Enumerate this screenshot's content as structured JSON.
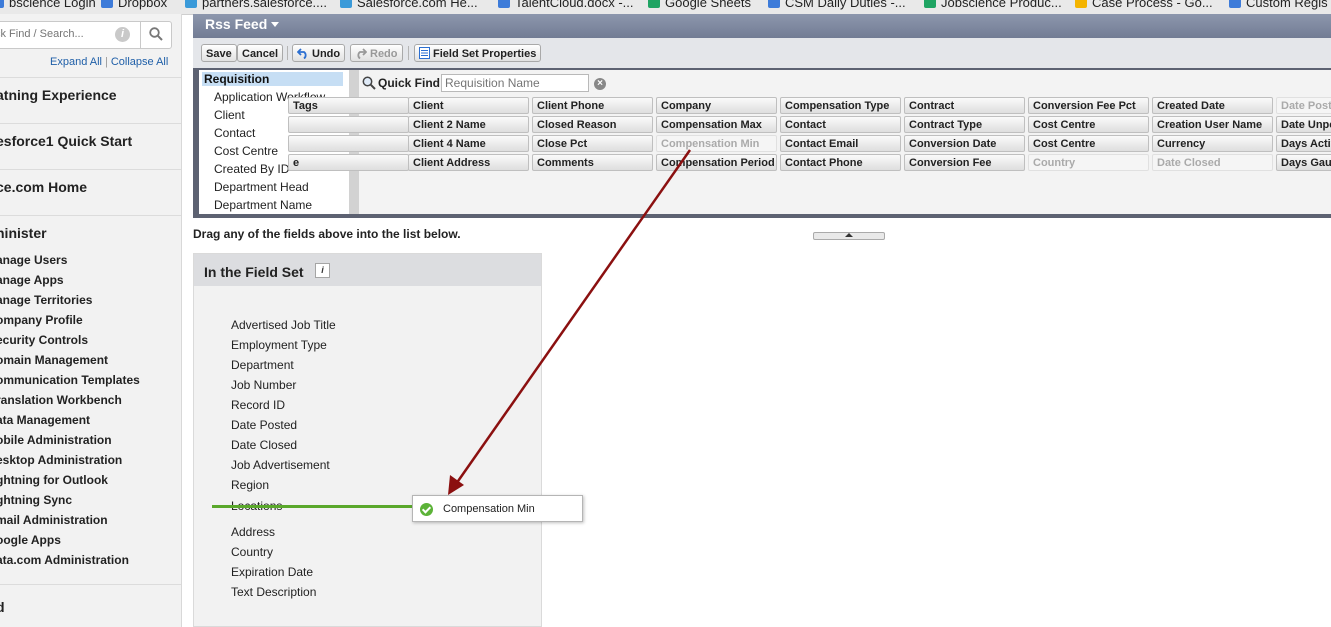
{
  "bookmarks": [
    {
      "label": "bscience Login",
      "icon": "bookmark-icon",
      "color": "#3d7bd9"
    },
    {
      "label": "Dropbox",
      "icon": "dropbox-icon",
      "color": "#3d7bd9"
    },
    {
      "label": "partners.salesforce....",
      "icon": "salesforce-icon",
      "color": "#3a9ad9"
    },
    {
      "label": "Salesforce.com He...",
      "icon": "salesforce-icon",
      "color": "#3a9ad9"
    },
    {
      "label": "TalentCloud.docx -...",
      "icon": "doc-icon",
      "color": "#3d7bd9"
    },
    {
      "label": "Google Sheets",
      "icon": "sheets-icon",
      "color": "#1fa463"
    },
    {
      "label": "CSM Daily Duties -...",
      "icon": "doc-icon",
      "color": "#3d7bd9"
    },
    {
      "label": "Jobscience Produc...",
      "icon": "sheets-icon",
      "color": "#1fa463"
    },
    {
      "label": "Case Process - Go...",
      "icon": "drive-icon",
      "color": "#f4b400"
    },
    {
      "label": "Custom Regis",
      "icon": "doc-icon",
      "color": "#3d7bd9"
    }
  ],
  "sidebar": {
    "search_placeholder": "ck Find / Search...",
    "expand_all": "Expand All",
    "collapse_all": "Collapse All",
    "sections": [
      "atning Experience",
      "esforce1 Quick Start",
      "ce.com Home",
      "ninister"
    ],
    "admin_links": [
      "anage Users",
      "anage Apps",
      "anage Territories",
      "ompany Profile",
      "ecurity Controls",
      "omain Management",
      "ommunication Templates",
      "ranslation Workbench",
      "ata Management",
      "obile Administration",
      "esktop Administration",
      "ghtning for Outlook",
      "ghtning Sync",
      "mail Administration",
      "oogle Apps",
      "ata.com Administration"
    ],
    "last_section": "d"
  },
  "header": {
    "title": "Rss Feed"
  },
  "toolbar": {
    "save": "Save",
    "cancel": "Cancel",
    "undo": "Undo",
    "redo": "Redo",
    "properties": "Field Set Properties"
  },
  "palette": {
    "objects": [
      "Requisition",
      "Application Workflow",
      "Client",
      "Contact",
      "Cost Centre",
      "Created By ID",
      "Department Head",
      "Department Name"
    ],
    "quick_find_label": "Quick Find",
    "quick_find_placeholder": "Requisition Name",
    "field_columns": [
      [
        "Tags",
        "",
        "",
        "e"
      ],
      [
        "Client",
        "Client 2 Name",
        "Client 4 Name",
        "Client Address"
      ],
      [
        "Client Phone",
        "Closed Reason",
        "Close Pct",
        "Comments"
      ],
      [
        "Company",
        "Compensation Max",
        "Compensation Min",
        "Compensation Period"
      ],
      [
        "Compensation Type",
        "Contact",
        "Contact Email",
        "Contact Phone"
      ],
      [
        "Contract",
        "Contract Type",
        "Conversion Date",
        "Conversion Fee"
      ],
      [
        "Conversion Fee Pct",
        "Cost Centre",
        "Cost Centre",
        "Country"
      ],
      [
        "Created Date",
        "Creation User Name",
        "Currency",
        "Date Closed"
      ],
      [
        "Date Posted",
        "Date Unpo",
        "Days Activ",
        "Days Gaug"
      ]
    ],
    "used_fields": [
      "Compensation Min",
      "Country",
      "Date Closed",
      "Date Posted"
    ]
  },
  "drag_hint": "Drag any of the fields above into the list below.",
  "fieldset": {
    "title": "In the Field Set",
    "items_before": [
      "Advertised Job Title",
      "Employment Type",
      "Department",
      "Job Number",
      "Record ID",
      "Date Posted",
      "Date Closed",
      "Job Advertisement",
      "Region",
      "Locations"
    ],
    "items_after": [
      "Address",
      "Country",
      "Expiration Date",
      "Text Description"
    ]
  },
  "drag_chip": {
    "label": "Compensation Min"
  },
  "colors": {
    "header": "#7b859c",
    "accent_link": "#1f5fa8",
    "drop_line": "#5aa82b",
    "arrow": "#8b1010",
    "selected": "#c6def4"
  }
}
